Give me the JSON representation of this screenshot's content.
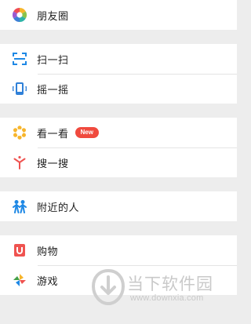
{
  "discover": {
    "groups": [
      {
        "items": [
          {
            "label": "朋友圈",
            "icon": "moments-icon"
          }
        ]
      },
      {
        "items": [
          {
            "label": "扫一扫",
            "icon": "scan-icon"
          },
          {
            "label": "摇一摇",
            "icon": "shake-icon"
          }
        ]
      },
      {
        "items": [
          {
            "label": "看一看",
            "icon": "top-stories-icon",
            "badge": "New"
          },
          {
            "label": "搜一搜",
            "icon": "search-icon"
          }
        ]
      },
      {
        "items": [
          {
            "label": "附近的人",
            "icon": "people-nearby-icon"
          }
        ]
      },
      {
        "items": [
          {
            "label": "购物",
            "icon": "shopping-icon"
          },
          {
            "label": "游戏",
            "icon": "games-icon"
          }
        ]
      }
    ]
  },
  "watermark": {
    "name": "当下软件园",
    "url": "www.downxia.com"
  },
  "colors": {
    "badge": "#f04a3e",
    "background": "#ededed",
    "row": "#ffffff"
  }
}
